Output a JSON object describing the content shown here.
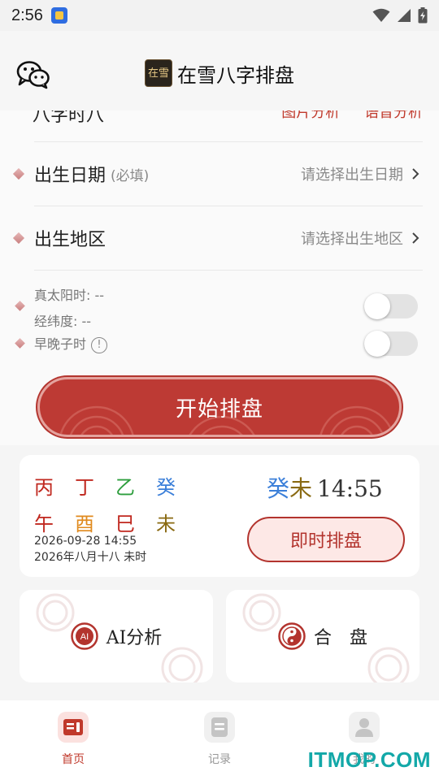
{
  "status_bar": {
    "time": "2:56"
  },
  "header": {
    "title": "在雪八字排盘",
    "logo_text": "在雪"
  },
  "form": {
    "partial_row": {
      "label": "八字时八",
      "option1": "图片分析",
      "option2": "语音分析"
    },
    "birth_date": {
      "label": "出生日期",
      "required": "(必填)",
      "placeholder": "请选择出生日期"
    },
    "birth_place": {
      "label": "出生地区",
      "placeholder": "请选择出生地区"
    },
    "true_solar_time": "真太阳时: --",
    "coordinates": "经纬度: --",
    "early_late_zi": {
      "label": "早晚子时",
      "info": "!"
    },
    "toggle_solar": false,
    "toggle_zi": false
  },
  "start_button": "开始排盘",
  "bazi": {
    "stems": [
      {
        "char": "丙",
        "color": "#c0281f"
      },
      {
        "char": "丁",
        "color": "#c0281f"
      },
      {
        "char": "乙",
        "color": "#2e9e3e"
      },
      {
        "char": "癸",
        "color": "#3b7fd9"
      }
    ],
    "branches": [
      {
        "char": "午",
        "color": "#c0281f"
      },
      {
        "char": "酉",
        "color": "#e08a1e"
      },
      {
        "char": "巳",
        "color": "#c0281f"
      },
      {
        "char": "未",
        "color": "#8a6a12"
      }
    ],
    "date_solar": "2026-09-28 14:55",
    "date_lunar": "2026年八月十八 未时",
    "now": {
      "stem": "癸",
      "stem_color": "#3b7fd9",
      "branch": "未",
      "branch_color": "#8a6a12",
      "time": "14:55"
    },
    "instant_button": "即时排盘"
  },
  "features": {
    "ai": "AI分析",
    "hepan": "合　盘"
  },
  "nav": [
    {
      "label": "首页",
      "active": true
    },
    {
      "label": "记录",
      "active": false
    },
    {
      "label": "我的",
      "active": false
    }
  ],
  "watermark": "ITMOP.COM",
  "colors": {
    "accent": "#bd3a34",
    "nav_active": "#c0392b",
    "nav_inactive": "#999999"
  }
}
